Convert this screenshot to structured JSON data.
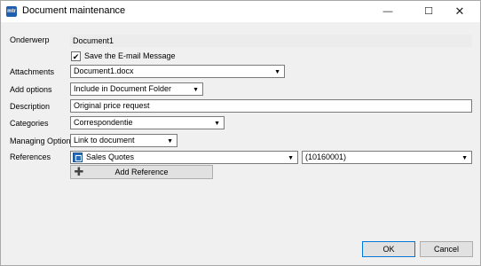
{
  "window": {
    "title": "Document maintenance",
    "app_icon_text": "mtr",
    "controls": {
      "minimize": "—",
      "maximize": "☐",
      "close": "✕"
    }
  },
  "form": {
    "subject": {
      "label": "Onderwerp",
      "value": "Document1"
    },
    "save_email": {
      "label": "Save the E-mail Message",
      "checked": true,
      "mark": "✔"
    },
    "attachments": {
      "label": "Attachments",
      "value": "Document1.docx"
    },
    "add_options": {
      "label": "Add options",
      "value": "Include in Document Folder"
    },
    "description": {
      "label": "Description",
      "value": "Original price request"
    },
    "categories": {
      "label": "Categories",
      "value": "Correspondentie"
    },
    "managing_option": {
      "label": "Managing Option",
      "value": "Link to document"
    },
    "references": {
      "label": "References",
      "type_value": "Sales Quotes",
      "number_value": "(10160001)",
      "add_button_label": "Add Reference",
      "add_button_icon": "✚"
    }
  },
  "buttons": {
    "ok": "OK",
    "cancel": "Cancel"
  },
  "dropdown_arrow": "▼"
}
